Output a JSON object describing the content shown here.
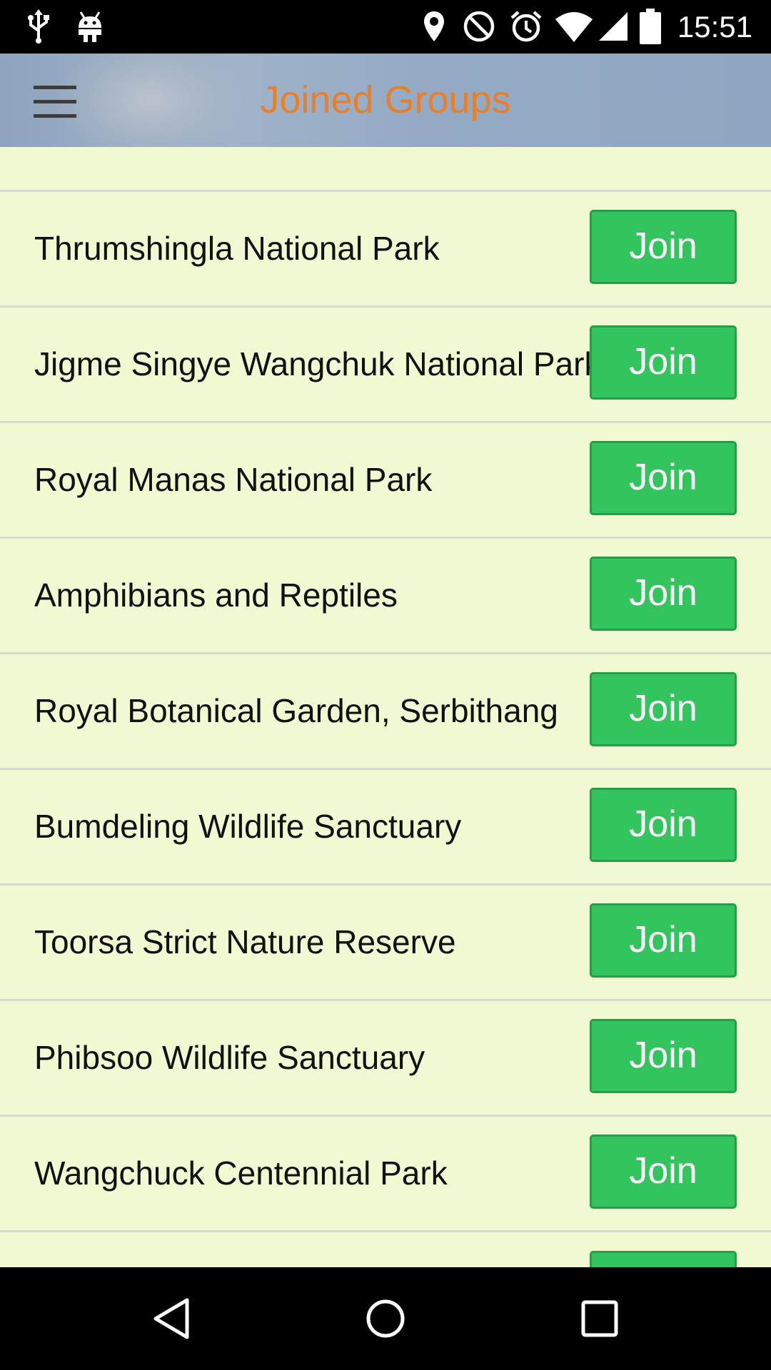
{
  "status_bar": {
    "time": "15:51",
    "icons": [
      "usb-icon",
      "android-debug-icon",
      "location-icon",
      "do-not-disturb-icon",
      "alarm-icon",
      "wifi-icon",
      "signal-icon",
      "battery-icon"
    ]
  },
  "header": {
    "title": "Joined Groups",
    "menu_icon": "hamburger-menu-icon"
  },
  "colors": {
    "title": "#e8802a",
    "join_button": "#34c45e",
    "list_background": "#f0f9d2"
  },
  "groups": [
    {
      "name": "Thrumshingla National Park",
      "action": "Join"
    },
    {
      "name": "Jigme Singye Wangchuk National Park",
      "action": "Join"
    },
    {
      "name": "Royal Manas National Park",
      "action": "Join"
    },
    {
      "name": "Amphibians and Reptiles",
      "action": "Join"
    },
    {
      "name": "Royal Botanical Garden, Serbithang",
      "action": "Join"
    },
    {
      "name": "Bumdeling Wildlife Sanctuary",
      "action": "Join"
    },
    {
      "name": "Toorsa Strict Nature Reserve",
      "action": "Join"
    },
    {
      "name": "Phibsoo Wildlife Sanctuary",
      "action": "Join"
    },
    {
      "name": "Wangchuck Centennial Park",
      "action": "Join"
    }
  ],
  "nav_bar": {
    "icons": [
      "back-icon",
      "home-icon",
      "recents-icon"
    ]
  }
}
